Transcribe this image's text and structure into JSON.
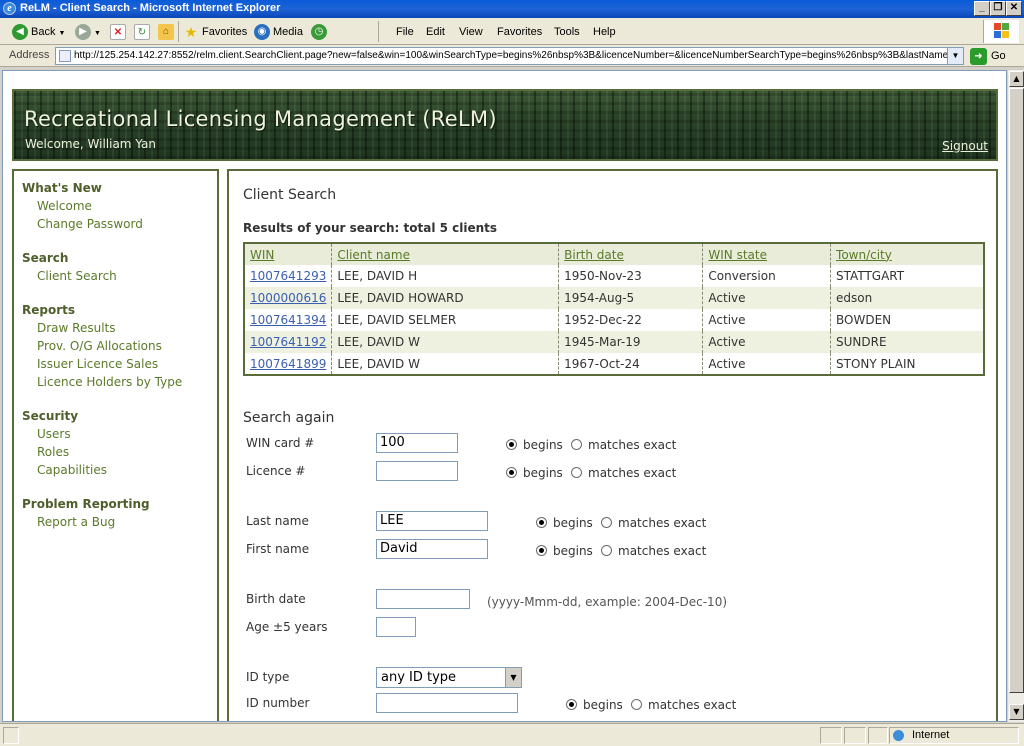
{
  "window": {
    "title": "ReLM - Client Search - Microsoft Internet Explorer",
    "btn_min": "_",
    "btn_max": "❐",
    "btn_close": "✕"
  },
  "toolbar": {
    "back": "Back",
    "favorites": "Favorites",
    "media": "Media",
    "menus": [
      "File",
      "Edit",
      "View",
      "Favorites",
      "Tools",
      "Help"
    ]
  },
  "address": {
    "label": "Address",
    "url": "http://125.254.142.27:8552/relm.client.SearchClient.page?new=false&win=100&winSearchType=begins%26nbsp%3B&licenceNumber=&licenceNumberSearchType=begins%26nbsp%3B&lastName",
    "go": "Go"
  },
  "banner": {
    "title": "Recreational Licensing Management (ReLM)",
    "welcome": "Welcome, William Yan",
    "signout": "Signout"
  },
  "sidebar": {
    "whats_new": "What's New",
    "welcome": "Welcome",
    "change_password": "Change Password",
    "search": "Search",
    "client_search": "Client Search",
    "reports": "Reports",
    "draw_results": "Draw Results",
    "prov_og": "Prov. O/G Allocations",
    "issuer_sales": "Issuer Licence Sales",
    "holders_by_type": "Licence Holders by Type",
    "security": "Security",
    "users": "Users",
    "roles": "Roles",
    "capabilities": "Capabilities",
    "problem_reporting": "Problem Reporting",
    "report_bug": "Report a Bug"
  },
  "main": {
    "title": "Client Search",
    "results_summary": "Results of your search: total 5 clients",
    "columns": [
      "WIN",
      "Client name",
      "Birth date",
      "WIN state",
      "Town/city"
    ],
    "rows": [
      {
        "win": "1007641293",
        "name": "LEE, DAVID H",
        "birth": "1950-Nov-23",
        "state": "Conversion",
        "town": "STATTGART"
      },
      {
        "win": "1000000616",
        "name": "LEE, DAVID HOWARD",
        "birth": "1954-Aug-5",
        "state": "Active",
        "town": "edson"
      },
      {
        "win": "1007641394",
        "name": "LEE, DAVID SELMER",
        "birth": "1952-Dec-22",
        "state": "Active",
        "town": "BOWDEN"
      },
      {
        "win": "1007641192",
        "name": "LEE, DAVID W",
        "birth": "1945-Mar-19",
        "state": "Active",
        "town": "SUNDRE"
      },
      {
        "win": "1007641899",
        "name": "LEE, DAVID W",
        "birth": "1967-Oct-24",
        "state": "Active",
        "town": "STONY PLAIN"
      }
    ]
  },
  "form": {
    "heading": "Search again",
    "win_label": "WIN card #",
    "win_value": "100",
    "licence_label": "Licence #",
    "licence_value": "",
    "last_label": "Last name",
    "last_value": "LEE",
    "first_label": "First name",
    "first_value": "David",
    "birth_label": "Birth date",
    "birth_value": "",
    "birth_hint": "(yyyy-Mmm-dd, example: 2004-Dec-10)",
    "age_label": "Age ±5 years",
    "age_value": "",
    "idtype_label": "ID type",
    "idtype_value": "any ID type",
    "idnum_label": "ID number",
    "idnum_value": "",
    "begins": "begins",
    "matches_exact": "matches exact"
  },
  "statusbar": {
    "zone": "Internet"
  }
}
